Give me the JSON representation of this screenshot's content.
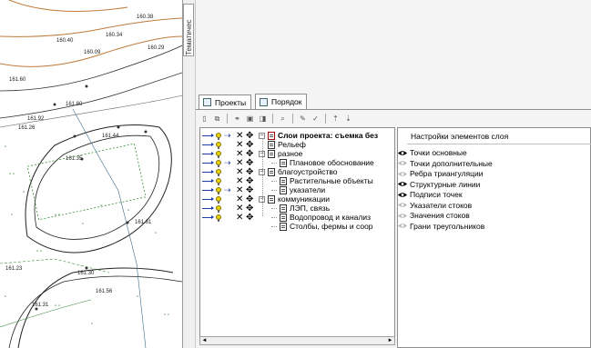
{
  "map": {
    "labels": [
      "160.38",
      "160.40",
      "160.34",
      "160.09",
      "160.29",
      "161.60",
      "161.80",
      "161.92",
      "161.26",
      "161.44",
      "161.35",
      "161.61",
      "161.23",
      "161.30",
      "161.56",
      "161.31"
    ]
  },
  "side_tab": {
    "label": "Тематичес"
  },
  "tabs": [
    {
      "label": "Проекты",
      "icon": "projects-icon"
    },
    {
      "label": "Порядок",
      "icon": "order-icon"
    }
  ],
  "toolbar": {
    "buttons": [
      "new-layer-icon",
      "copy-layer-icon",
      "link-icon",
      "paste-icon",
      "layer-props-icon",
      "zoom-icon",
      "draw-icon",
      "check-icon",
      "move-up-icon",
      "move-down-icon"
    ]
  },
  "tree": {
    "root": "Слои проекта: съемка без",
    "items": [
      {
        "label": "Рельеф",
        "level": 1,
        "expander": ""
      },
      {
        "label": "разное",
        "level": 1,
        "expander": "−"
      },
      {
        "label": "Плановое обоснование",
        "level": 2,
        "expander": ""
      },
      {
        "label": "благоустройство",
        "level": 1,
        "expander": "−"
      },
      {
        "label": "Растительные объекты",
        "level": 2,
        "expander": ""
      },
      {
        "label": "указатели",
        "level": 2,
        "expander": ""
      },
      {
        "label": "коммуникации",
        "level": 1,
        "expander": "−"
      },
      {
        "label": "ЛЭП, связь",
        "level": 2,
        "expander": ""
      },
      {
        "label": "Водопровод и канализ",
        "level": 2,
        "expander": ""
      },
      {
        "label": "Столбы, фермы и соор",
        "level": 2,
        "expander": ""
      }
    ],
    "controls": [
      {
        "arrow": true,
        "bulb": true,
        "sel": "⇢",
        "x": "✕",
        "move": "✥"
      },
      {
        "arrow": true,
        "bulb": true,
        "sel": "",
        "x": "✕",
        "move": "✥"
      },
      {
        "arrow": true,
        "bulb": true,
        "sel": "",
        "x": "✕",
        "move": "✥"
      },
      {
        "arrow": true,
        "bulb": true,
        "sel": "⇢",
        "x": "✕",
        "move": "✥"
      },
      {
        "arrow": true,
        "bulb": true,
        "sel": "",
        "x": "✕",
        "move": "✥"
      },
      {
        "arrow": true,
        "bulb": true,
        "sel": "",
        "x": "✕",
        "move": "✥"
      },
      {
        "arrow": true,
        "bulb": true,
        "sel": "⇢",
        "x": "✕",
        "move": "✥"
      },
      {
        "arrow": true,
        "bulb": true,
        "sel": "",
        "x": "✕",
        "move": "✥"
      },
      {
        "arrow": true,
        "bulb": true,
        "sel": "",
        "x": "✕",
        "move": "✥"
      },
      {
        "arrow": true,
        "bulb": true,
        "sel": "",
        "x": "✕",
        "move": "✥"
      }
    ]
  },
  "settings": {
    "header": "Настройки элементов слоя",
    "items": [
      {
        "label": "Точки основные",
        "visible": true
      },
      {
        "label": "Точки дополнительные",
        "visible": false
      },
      {
        "label": "Ребра триангуляции",
        "visible": false
      },
      {
        "label": "Структурные линии",
        "visible": true
      },
      {
        "label": "Подписи точек",
        "visible": true
      },
      {
        "label": "Указатели стоков",
        "visible": false
      },
      {
        "label": "Значения стоков",
        "visible": false
      },
      {
        "label": "Грани треугольников",
        "visible": false
      }
    ]
  },
  "scroll": {
    "left": "◄",
    "right": "►"
  }
}
